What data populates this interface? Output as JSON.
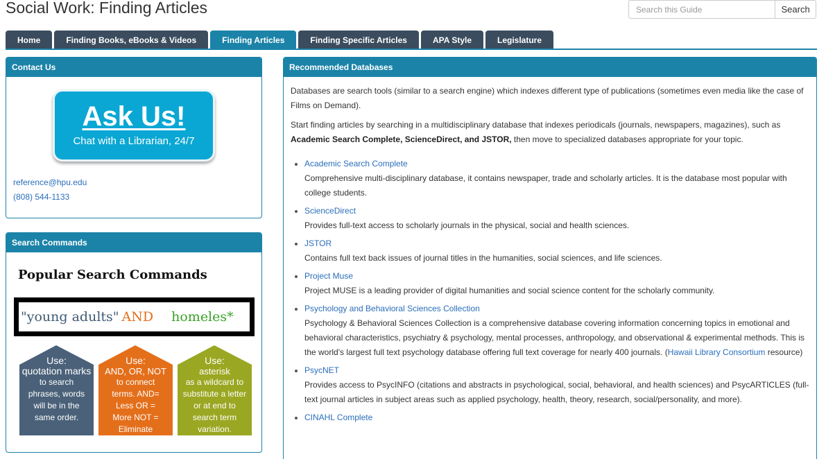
{
  "page_title": "Social Work: Finding Articles",
  "search": {
    "placeholder": "Search this Guide",
    "button_label": "Search"
  },
  "tabs": [
    {
      "label": "Home"
    },
    {
      "label": "Finding Books, eBooks & Videos"
    },
    {
      "label": "Finding Articles",
      "active": true
    },
    {
      "label": "Finding Specific Articles"
    },
    {
      "label": "APA Style"
    },
    {
      "label": "Legislature"
    }
  ],
  "contact": {
    "heading": "Contact Us",
    "askus_title": "Ask Us!",
    "askus_subtitle": "Chat with a Librarian, 24/7",
    "email": "reference@hpu.edu",
    "phone": "(808) 544-1133"
  },
  "search_commands": {
    "heading": "Search Commands",
    "image_title": "Popular Search Commands",
    "example_quoted": "\"young adults\"",
    "example_and": "AND",
    "example_wild": "homeles*",
    "houses": [
      {
        "use": "Use:",
        "head": "quotation marks",
        "body": "to search phrases, words will be in the same order.",
        "color": "#4a6179"
      },
      {
        "use": "Use:",
        "head": "AND, OR, NOT",
        "body": "to connect terms. AND= Less OR = More NOT = Eliminate",
        "color": "#e46f1b"
      },
      {
        "use": "Use:",
        "head": "asterisk",
        "body": "as a wildcard to substitute a letter or at end to search term variation.",
        "color": "#9aa722"
      }
    ]
  },
  "databases": {
    "heading": "Recommended Databases",
    "intro1": "Databases are search tools (similar to a search engine) which indexes different type of publications (sometimes even media like the case of Films on Demand).",
    "intro2_a": "Start finding articles by searching in a multidisciplinary database that indexes periodicals (journals, newspapers, magazines), such as",
    "intro2_bold": "Academic Search Complete, ScienceDirect, and JSTOR,",
    "intro2_b": " then move to specialized databases appropriate for your topic.",
    "items": [
      {
        "name": "Academic Search Complete",
        "desc": "Comprehensive multi-disciplinary database, it contains newspaper, trade and scholarly articles. It is the database most popular with college students."
      },
      {
        "name": "ScienceDirect",
        "desc": "Provides full-text access to scholarly journals in the physical, social and health sciences."
      },
      {
        "name": "JSTOR",
        "desc": "Contains full text back issues of journal titles in the humanities, social sciences, and life sciences."
      },
      {
        "name": "Project Muse",
        "desc": "Project MUSE is a leading provider of digital humanities and social science content for the scholarly community."
      },
      {
        "name": "Psychology and Behavioral Sciences Collection",
        "desc": "Psychology & Behavioral Sciences Collection is a comprehensive database covering information concerning topics in emotional and behavioral characteristics, psychiatry & psychology, mental processes, anthropology, and observational & experimental methods. This is the world's largest full text psychology database offering full text coverage for nearly 400 journals. (",
        "link": "Hawaii Library Consortium",
        "desc_tail": " resource)"
      },
      {
        "name": "PsycNET",
        "desc": "Provides access to PsycINFO (citations and abstracts in psychological, social, behavioral, and health sciences) and PsycARTICLES (full-text journal articles in subject areas such as applied psychology, health, theory, research, social/personality, and more)."
      },
      {
        "name": "CINAHL Complete",
        "desc": ""
      }
    ]
  }
}
